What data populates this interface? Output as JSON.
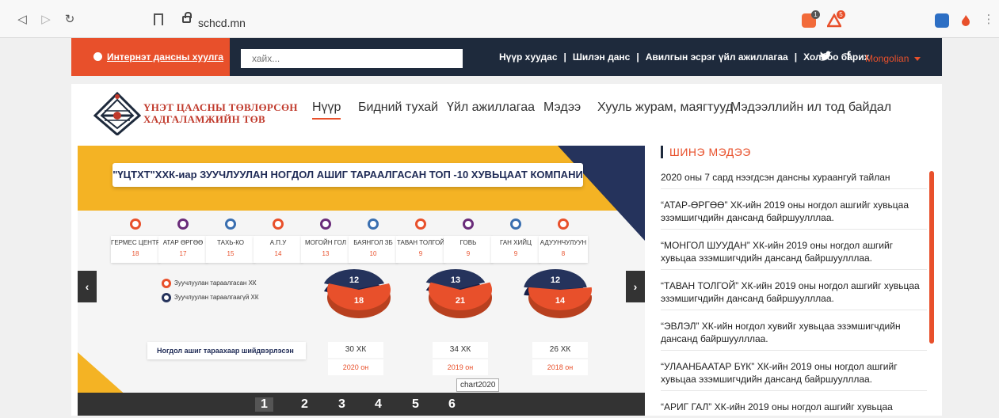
{
  "browser": {
    "url": "schcd.mn",
    "ext_badge_1": "1",
    "ext_badge_2": "5"
  },
  "header": {
    "online_account": "Интернэт дансны хуулга",
    "search_placeholder": "хайх...",
    "nav": [
      "Нүүр хуудас",
      "Шилэн данс",
      "Авилгын эсрэг үйл ажиллагаа",
      "Холбоо барих"
    ],
    "language": "Mongolian"
  },
  "logo": {
    "line1": "ҮНЭТ ЦААСНЫ ТӨВЛӨРСӨН",
    "line2": "ХАДГАЛАМЖИЙН ТӨВ"
  },
  "main_nav": [
    "Нүүр",
    "Бидний тухай",
    "Үйл ажиллагаа",
    "Мэдээ",
    "Хууль журам, маягтууд",
    "Мэдээллийн ил тод байдал"
  ],
  "slide": {
    "title": "\"ҮЦТХТ\"ХХК-иар ЗУУЧЛУУЛАН НОГДОЛ АШИГ ТАРААЛГАСАН ТОП -10 ХУВЬЦААТ КОМПАНИ",
    "companies": [
      {
        "name": "ГЕРМЕС ЦЕНТР",
        "count": "18",
        "color": "#e8502b"
      },
      {
        "name": "АТАР ӨРГӨӨ",
        "count": "17",
        "color": "#6a2c7a"
      },
      {
        "name": "ТАХЬ-КО",
        "count": "15",
        "color": "#3a6fb0"
      },
      {
        "name": "А.П.У",
        "count": "14",
        "color": "#e8502b"
      },
      {
        "name": "МОГОЙН ГОЛ",
        "count": "13",
        "color": "#6a2c7a"
      },
      {
        "name": "БАЯНГОЛ ЗБ",
        "count": "10",
        "color": "#3a6fb0"
      },
      {
        "name": "ТАВАН ТОЛГОЙ",
        "count": "9",
        "color": "#e8502b"
      },
      {
        "name": "ГОВЬ",
        "count": "9",
        "color": "#6a2c7a"
      },
      {
        "name": "ГАН ХИЙЦ",
        "count": "9",
        "color": "#3a6fb0"
      },
      {
        "name": "АДУУНЧУЛУУН",
        "count": "8",
        "color": "#e8502b"
      }
    ],
    "legend": [
      "Зуучлуулан тараалгасан ХК",
      "Зуучлуулан тараалгаагүй ХК"
    ],
    "table_label": "Ногдол ашиг тараахаар шийдвэрлэсэн",
    "years": [
      {
        "total": "30 ХК",
        "year": "2020 он"
      },
      {
        "total": "34 ХК",
        "year": "2019 он"
      },
      {
        "total": "26 ХК",
        "year": "2018 он"
      }
    ],
    "pager": [
      "1",
      "2",
      "3",
      "4",
      "5",
      "6"
    ],
    "tooltip": "chart2020",
    "prev": "‹",
    "next": "›"
  },
  "chart_data": [
    {
      "type": "pie",
      "categories": [
        "Зуучлуулан тараалгасан ХК",
        "Зуучлуулан тараалгаагүй ХК"
      ],
      "values": [
        18,
        12
      ]
    },
    {
      "type": "pie",
      "categories": [
        "Зуучлуулан тараалгасан ХК",
        "Зуучлуулан тараалгаагүй ХК"
      ],
      "values": [
        21,
        13
      ]
    },
    {
      "type": "pie",
      "categories": [
        "Зуучлуулан тараалгасан ХК",
        "Зуучлуулан тараалгаагүй ХК"
      ],
      "values": [
        14,
        12
      ]
    }
  ],
  "colors": {
    "orange": "#e8502b",
    "navy": "#25335c"
  },
  "news": {
    "heading": "ШИНЭ МЭДЭЭ",
    "items": [
      "2020 оны 7 сард нээгдсэн дансны хураангуй тайлан",
      "“АТАР-ӨРГӨӨ” ХК-ийн 2019 оны ногдол ашгийг хувьцаа эзэмшигчдийн дансанд байршуулллаа.",
      "“МОНГОЛ ШУУДАН” ХК-ийн 2019 оны ногдол ашгийг хувьцаа эзэмшигчдийн дансанд байршуулллаа.",
      "“ТАВАН ТОЛГОЙ” ХК-ийн 2019 оны ногдол ашгийг хувьцаа эзэмшигчдийн дансанд байршуулллаа.",
      "“ЭВЛЭЛ” ХК-ийн ногдол хувийг хувьцаа эзэмшигчдийн дансанд байршуулллаа.",
      "“УЛААНБААТАР БҮК” ХК-ийн 2019 оны ногдол ашгийг хувьцаа эзэмшигчдийн дансанд байршуулллаа.",
      "“АРИГ ГАЛ” ХК-ийн 2019 оны ногдол ашгийг хувьцаа"
    ]
  }
}
